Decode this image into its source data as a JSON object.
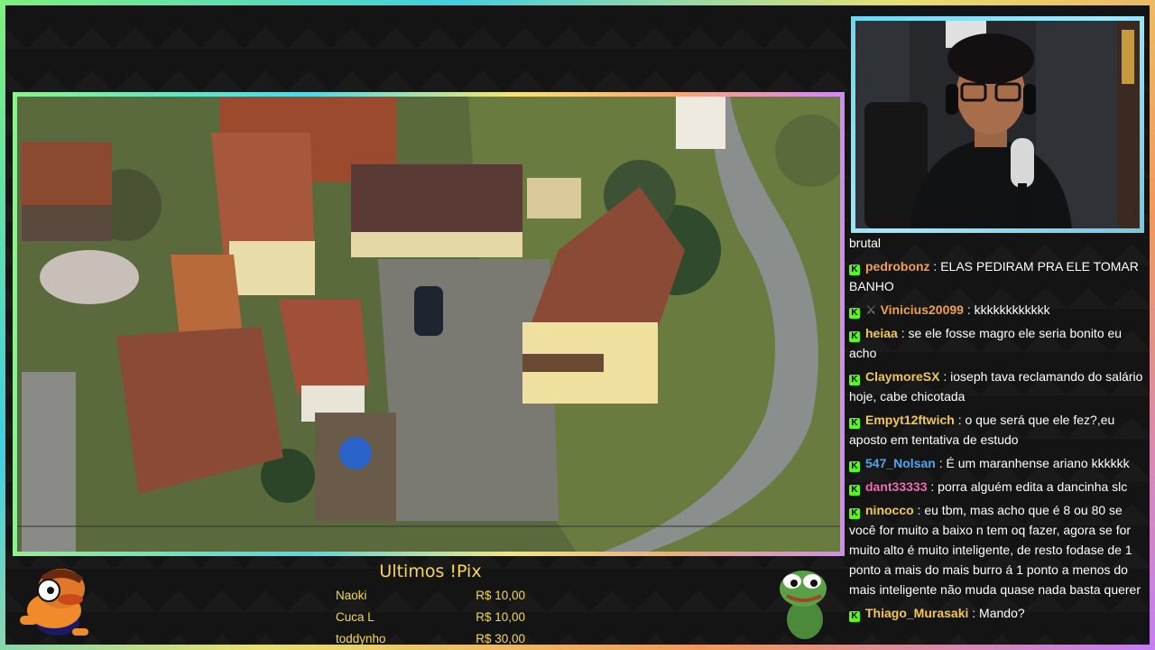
{
  "colors": {
    "kick_green": "#53fc18",
    "pix_yellow": "#f7d94a",
    "border_gradient": [
      "#7df07d",
      "#40d0e0",
      "#e8e070",
      "#f09a5a",
      "#c47ef0"
    ]
  },
  "chat": {
    "messages": [
      {
        "user": "",
        "text": "brutal",
        "color": "#ffffff",
        "badge": false
      },
      {
        "user": "pedrobonz",
        "text": "ELAS PEDIRAM PRA ELE TOMAR BANHO",
        "color": "#f4a04a",
        "badge": true
      },
      {
        "user": "Vinicius20099",
        "text": "kkkkkkkkkkkk",
        "color": "#f4a04a",
        "badge": true
      },
      {
        "user": "heiaa",
        "text": "se ele fosse magro ele seria bonito eu acho",
        "color": "#f4c84a",
        "badge": true
      },
      {
        "user": "ClaymoreSX",
        "text": "ioseph tava reclamando do salário hoje, cabe chicotada",
        "color": "#f4c84a",
        "badge": true
      },
      {
        "user": "Empyt12ftwich",
        "text": "o que será que ele fez?,eu aposto em tentativa de estudo",
        "color": "#f4c84a",
        "badge": true
      },
      {
        "user": "547_Nolsan",
        "text": "É um maranhense ariano kkkkkk",
        "color": "#4aa8f4",
        "badge": true
      },
      {
        "user": "dant33333",
        "text": "porra alguém edita a dancinha slc",
        "color": "#f46ab0",
        "badge": true
      },
      {
        "user": "ninocco",
        "text": "eu tbm, mas acho que é 8 ou 80 se você for muito a baixo n tem oq fazer, agora se for muito alto é muito inteligente, de resto fodase de 1 ponto a mais do mais burro á 1 ponto a menos do mais inteligente não muda quase nada basta querer",
        "color": "#f4c84a",
        "badge": true
      },
      {
        "user": "Thiago_Murasaki",
        "text": "Mando?",
        "color": "#f4c84a",
        "badge": true
      }
    ]
  },
  "pix": {
    "title": "Ultimos !Pix",
    "rows": [
      {
        "name": "Naoki",
        "amount": "R$ 10,00"
      },
      {
        "name": "Cuca L",
        "amount": "R$ 10,00"
      },
      {
        "name": "toddynho",
        "amount": "R$ 30,00"
      }
    ]
  },
  "icons": {
    "kick_badge": "K",
    "left_mascot": "mascot-icon",
    "right_mascot": "pepe-frog-icon"
  }
}
